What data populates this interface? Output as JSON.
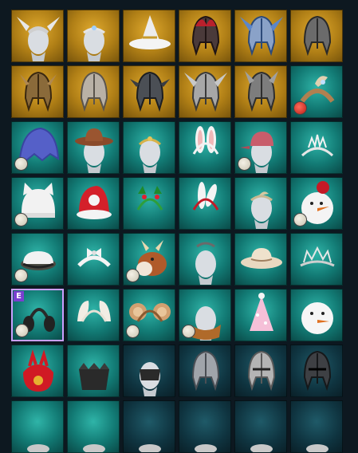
{
  "colors": {
    "gold_slot": "#c3901e",
    "teal_slot": "#1a8f88",
    "dark_slot": "#12404c",
    "selected_border": "#c9a0ff",
    "badge": "#7a3fd0"
  },
  "inventory": {
    "columns": 6,
    "badge_label": "E",
    "items": [
      {
        "icon": "winged-crown-helm-icon",
        "bg": "gold"
      },
      {
        "icon": "silver-circlet-icon",
        "bg": "gold"
      },
      {
        "icon": "witch-hat-icon",
        "bg": "gold"
      },
      {
        "icon": "red-feather-helm-icon",
        "bg": "gold"
      },
      {
        "icon": "blue-winged-helm-icon",
        "bg": "gold"
      },
      {
        "icon": "dark-knight-helm-icon",
        "bg": "gold"
      },
      {
        "icon": "bronze-horned-helm-icon",
        "bg": "gold"
      },
      {
        "icon": "silver-helm-icon",
        "bg": "gold"
      },
      {
        "icon": "dark-spiked-helm-icon",
        "bg": "gold"
      },
      {
        "icon": "winged-half-helm-icon",
        "bg": "gold"
      },
      {
        "icon": "horned-war-helm-icon",
        "bg": "gold"
      },
      {
        "icon": "feathered-headband-icon",
        "bg": "teal",
        "dye": "red"
      },
      {
        "icon": "blue-hood-icon",
        "bg": "teal",
        "dye": "white"
      },
      {
        "icon": "cowboy-hat-icon",
        "bg": "teal"
      },
      {
        "icon": "gold-circlet-icon",
        "bg": "teal"
      },
      {
        "icon": "bunny-ears-icon",
        "bg": "teal"
      },
      {
        "icon": "pink-cap-icon",
        "bg": "teal",
        "dye": "white"
      },
      {
        "icon": "tiara-icon",
        "bg": "teal"
      },
      {
        "icon": "knit-cat-hat-icon",
        "bg": "teal",
        "dye": "white"
      },
      {
        "icon": "santa-hat-icon",
        "bg": "teal"
      },
      {
        "icon": "holly-headband-icon",
        "bg": "teal"
      },
      {
        "icon": "rabbit-ears-icon",
        "bg": "teal"
      },
      {
        "icon": "leaf-circlet-icon",
        "bg": "teal"
      },
      {
        "icon": "snowman-mask-icon",
        "bg": "teal",
        "dye": "white"
      },
      {
        "icon": "military-cap-icon",
        "bg": "teal",
        "dye": "white"
      },
      {
        "icon": "white-bow-band-icon",
        "bg": "teal"
      },
      {
        "icon": "reindeer-head-icon",
        "bg": "teal",
        "dye": "white"
      },
      {
        "icon": "dark-circlet-icon",
        "bg": "teal"
      },
      {
        "icon": "straw-hat-icon",
        "bg": "teal"
      },
      {
        "icon": "silver-crown-icon",
        "bg": "teal"
      },
      {
        "icon": "black-earmuffs-icon",
        "bg": "teal",
        "dye": "white",
        "badge": true,
        "selected": true
      },
      {
        "icon": "fluffy-ears-icon",
        "bg": "teal"
      },
      {
        "icon": "bear-ears-icon",
        "bg": "teal",
        "dye": "white"
      },
      {
        "icon": "bronze-scarf-icon",
        "bg": "teal",
        "dye": "white"
      },
      {
        "icon": "party-hat-icon",
        "bg": "teal"
      },
      {
        "icon": "snowman-head-icon",
        "bg": "teal"
      },
      {
        "icon": "red-pouch-icon",
        "bg": "teal"
      },
      {
        "icon": "black-mask-icon",
        "bg": "teal"
      },
      {
        "icon": "face-visor-icon",
        "bg": "dark"
      },
      {
        "icon": "steel-helm-icon",
        "bg": "dark"
      },
      {
        "icon": "knight-helm-icon",
        "bg": "dark"
      },
      {
        "icon": "dark-helm-icon",
        "bg": "dark"
      },
      {
        "icon": "partial-item-icon",
        "bg": "teal"
      },
      {
        "icon": "partial-item-icon",
        "bg": "teal"
      },
      {
        "icon": "partial-item-icon",
        "bg": "dark"
      },
      {
        "icon": "partial-item-icon",
        "bg": "dark"
      },
      {
        "icon": "partial-item-icon",
        "bg": "dark"
      },
      {
        "icon": "partial-item-icon",
        "bg": "dark"
      }
    ]
  }
}
